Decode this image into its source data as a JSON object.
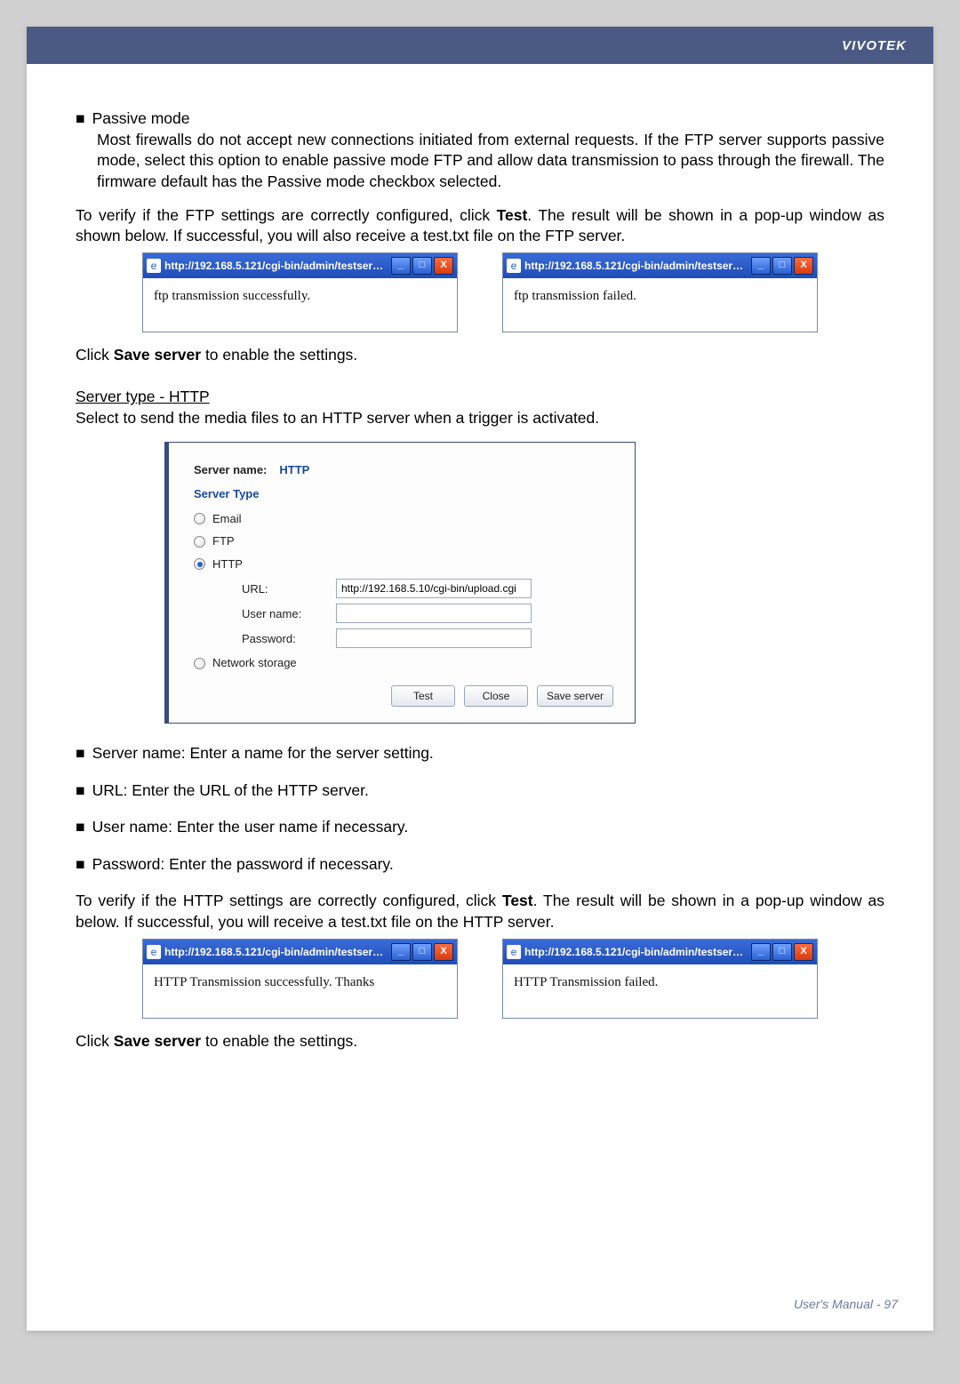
{
  "brand": "VIVOTEK",
  "passive": {
    "title": "Passive mode",
    "body": "Most firewalls do not accept new connections initiated from external requests. If the FTP server supports passive mode, select this option to enable passive mode FTP and allow data transmission to pass through the firewall. The firmware default has the Passive mode checkbox selected."
  },
  "ftp_verify_pre": "To verify if the FTP settings are correctly configured, click ",
  "ftp_verify_bold": "Test",
  "ftp_verify_post": ". The result will be shown in a pop-up window as shown below. If successful, you will also receive a test.txt file on the FTP server.",
  "popup_title": "http://192.168.5.121/cgi-bin/admin/testserver.cgi - ...",
  "ftp_ok": "ftp transmission successfully.",
  "ftp_fail": "ftp transmission failed.",
  "save_pre": "Click ",
  "save_bold": "Save server",
  "save_post": " to enable the settings.",
  "http_section_title": "Server type - HTTP",
  "http_section_desc": "Select to send the media files to an HTTP server when a trigger is activated.",
  "form": {
    "server_name_label": "Server name:",
    "server_name_value": "HTTP",
    "server_type_heading": "Server Type",
    "opt_email": "Email",
    "opt_ftp": "FTP",
    "opt_http": "HTTP",
    "url_label": "URL:",
    "url_value": "http://192.168.5.10/cgi-bin/upload.cgi",
    "user_label": "User name:",
    "user_value": "",
    "pass_label": "Password:",
    "pass_value": "",
    "opt_ns": "Network storage",
    "btn_test": "Test",
    "btn_close": "Close",
    "btn_save": "Save server"
  },
  "bullets": {
    "b1": "Server name: Enter a name for the server setting.",
    "b2": "URL: Enter the URL of the HTTP server.",
    "b3": "User name: Enter the user name if necessary.",
    "b4": "Password: Enter the password if necessary."
  },
  "http_verify_pre": "To verify if the HTTP settings are correctly configured, click ",
  "http_verify_bold": "Test",
  "http_verify_post": ". The result will be shown in a pop-up window as below. If successful, you will receive a test.txt file on the HTTP server.",
  "http_ok": "HTTP Transmission successfully. Thanks",
  "http_fail": "HTTP Transmission failed.",
  "footer_label": "User's Manual - ",
  "footer_page": "97",
  "win_min": "_",
  "win_max": "□",
  "win_close": "X",
  "ie_glyph": "e"
}
